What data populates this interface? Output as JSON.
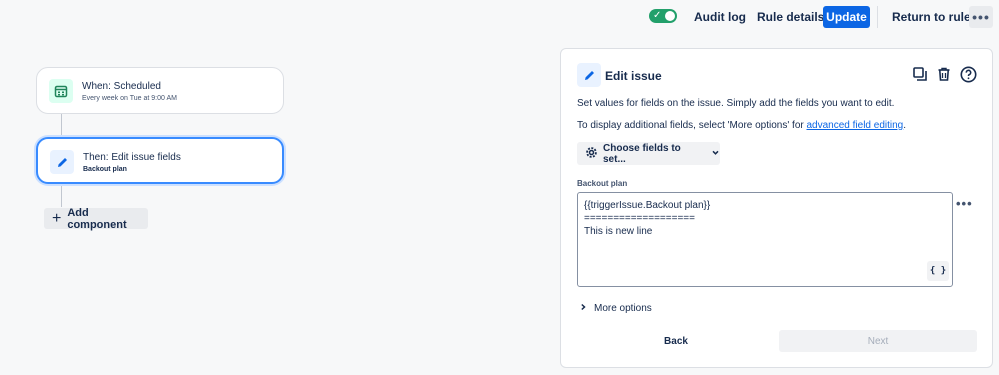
{
  "topbar": {
    "enabled": true,
    "audit_log": "Audit log",
    "rule_details": "Rule details",
    "update": "Update",
    "return": "Return to rules",
    "more": "•••"
  },
  "flow": {
    "trigger": {
      "title": "When: Scheduled",
      "subtitle": "Every week on Tue at 9:00 AM",
      "icon": "calendar-icon"
    },
    "action": {
      "title": "Then: Edit issue fields",
      "subtitle": "Backout plan",
      "icon": "pencil-icon"
    },
    "add_component": "Add component"
  },
  "panel": {
    "title": "Edit issue",
    "description": "Set values for fields on the issue. Simply add the fields you want to edit.",
    "additional_prefix": "To display additional fields, select 'More options' for ",
    "additional_link": "advanced field editing",
    "additional_suffix": ".",
    "choose_fields": "Choose fields to set...",
    "field_label": "Backout plan",
    "field_value": "{{triggerIssue.Backout plan}}\n===================\nThis is new line",
    "smart_value_btn": "{ }",
    "field_more": "•••",
    "more_options": "More options",
    "back": "Back",
    "next": "Next"
  },
  "colors": {
    "accent": "#0c66e4",
    "toggle_on": "#22a06b",
    "selected_border": "#388bff"
  }
}
